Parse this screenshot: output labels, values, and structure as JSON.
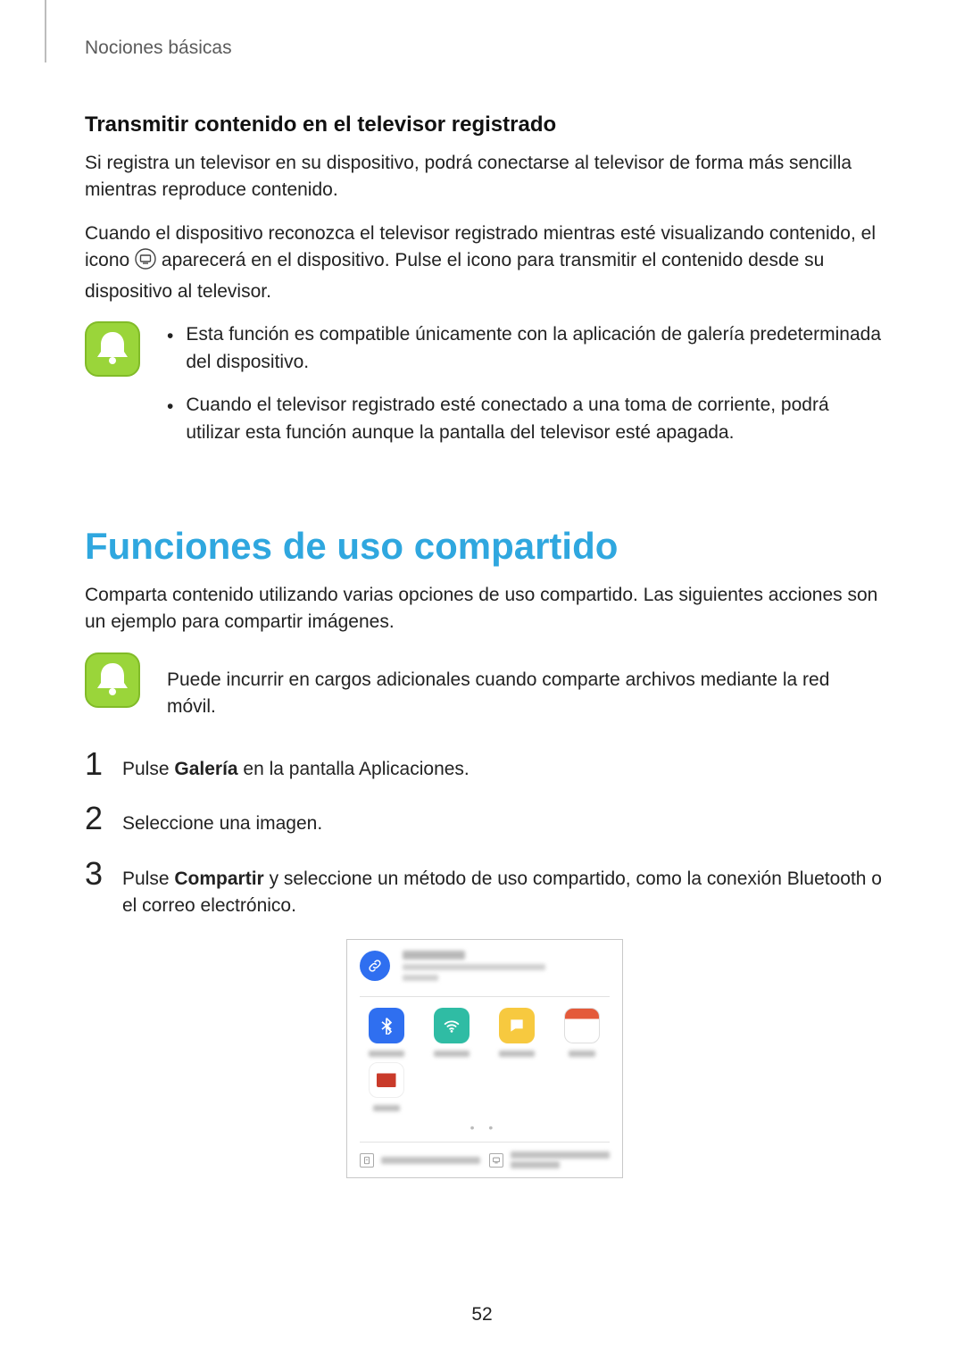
{
  "breadcrumb": "Nociones básicas",
  "section1": {
    "heading": "Transmitir contenido en el televisor registrado",
    "para1": "Si registra un televisor en su dispositivo, podrá conectarse al televisor de forma más sencilla mientras reproduce contenido.",
    "para2a": "Cuando el dispositivo reconozca el televisor registrado mientras esté visualizando contenido, el icono ",
    "para2b": " aparecerá en el dispositivo. Pulse el icono para transmitir el contenido desde su dispositivo al televisor.",
    "bullets": [
      "Esta función es compatible únicamente con la aplicación de galería predeterminada del dispositivo.",
      "Cuando el televisor registrado esté conectado a una toma de corriente, podrá utilizar esta función aunque la pantalla del televisor esté apagada."
    ]
  },
  "section2": {
    "heading": "Funciones de uso compartido",
    "intro": "Comparta contenido utilizando varias opciones de uso compartido. Las siguientes acciones son un ejemplo para compartir imágenes.",
    "notice": "Puede incurrir en cargos adicionales cuando comparte archivos mediante la red móvil.",
    "steps": {
      "n1": "1",
      "s1a": "Pulse ",
      "s1bold": "Galería",
      "s1b": " en la pantalla Aplicaciones.",
      "n2": "2",
      "s2": "Seleccione una imagen.",
      "n3": "3",
      "s3a": "Pulse ",
      "s3bold": "Compartir",
      "s3b": " y seleccione un método de uso compartido, como la conexión Bluetooth o el correo electrónico."
    }
  },
  "bullet_dot": "•",
  "page_number": "52",
  "mock": {
    "dots": "•  •"
  }
}
